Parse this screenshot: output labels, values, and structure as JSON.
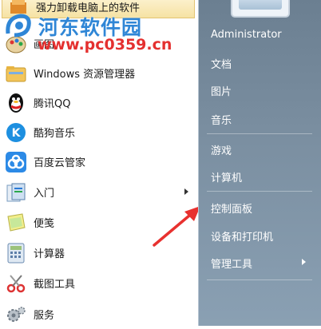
{
  "left_menu": {
    "items": [
      {
        "label": "强力卸载电脑上的软件",
        "icon": "uninstall-icon"
      },
      {
        "label": "画图",
        "icon": "paint-icon"
      },
      {
        "label": "Windows 资源管理器",
        "icon": "folder-explorer-icon"
      },
      {
        "label": "腾讯QQ",
        "icon": "qq-penguin-icon"
      },
      {
        "label": "酷狗音乐",
        "icon": "kugou-music-icon"
      },
      {
        "label": "百度云管家",
        "icon": "baidu-cloud-icon"
      },
      {
        "label": "入门",
        "icon": "getting-started-icon"
      },
      {
        "label": "便笺",
        "icon": "sticky-notes-icon"
      },
      {
        "label": "计算器",
        "icon": "calculator-icon"
      },
      {
        "label": "截图工具",
        "icon": "snipping-tool-icon"
      },
      {
        "label": "服务",
        "icon": "services-gear-icon"
      }
    ]
  },
  "right_menu": {
    "items": [
      {
        "label": "Administrator"
      },
      {
        "label": "文档"
      },
      {
        "label": "图片"
      },
      {
        "label": "音乐"
      },
      {
        "label": "游戏"
      },
      {
        "label": "计算机"
      },
      {
        "label": "控制面板"
      },
      {
        "label": "设备和打印机"
      },
      {
        "label": "管理工具"
      }
    ]
  },
  "watermark": {
    "title": "河东软件园",
    "url": "www.pc0359.cn"
  },
  "colors": {
    "right_panel": "#7a8ea0",
    "highlight": "#f6e2a3",
    "arrow": "#e8312f",
    "watermark_title": "#2f86d6",
    "watermark_url": "#e4302f"
  }
}
